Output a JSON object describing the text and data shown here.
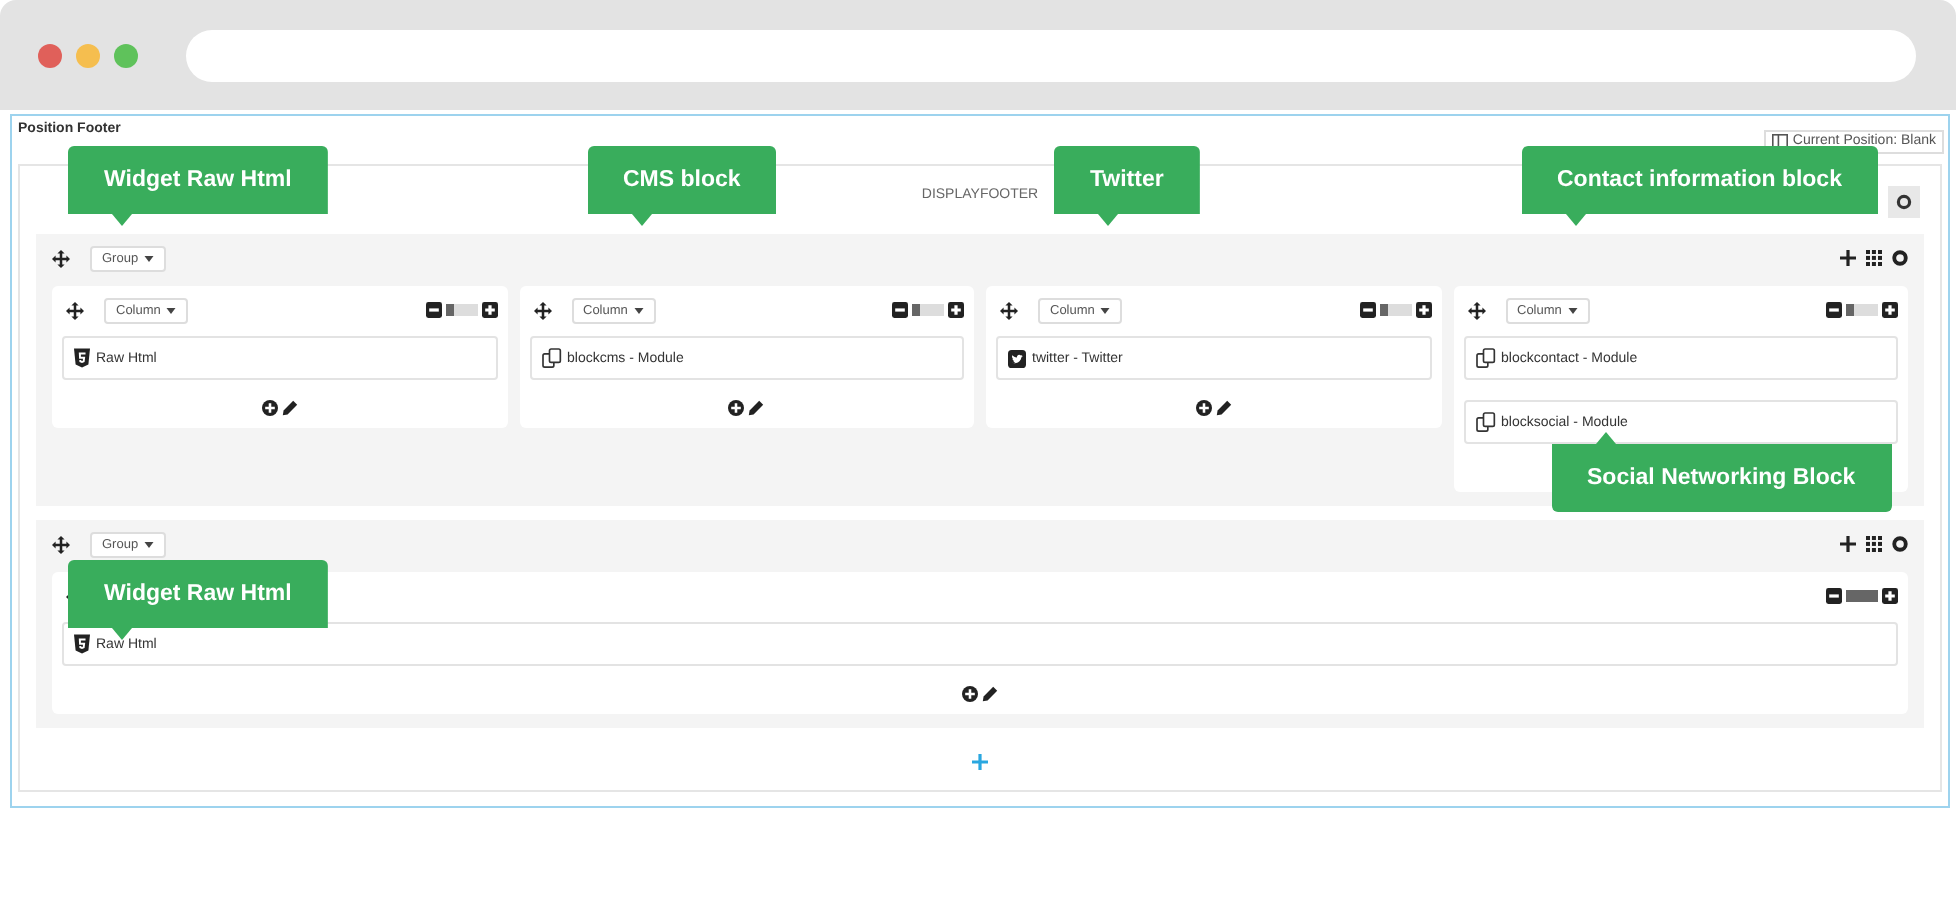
{
  "browser": {
    "dots": [
      {
        "color": "#e0605a"
      },
      {
        "color": "#f5be4f"
      },
      {
        "color": "#5fc25b"
      }
    ]
  },
  "panel": {
    "title": "Position Footer",
    "position_button": "Current Position: Blank",
    "hook": "DISPLAYFOOTER",
    "groups": [
      {
        "label": "Group",
        "columns": [
          {
            "label": "Column",
            "level": 0.25,
            "callout": {
              "text": "Widget Raw Html",
              "kind": "above-start"
            },
            "modules": [
              {
                "kind": "html",
                "text": "Raw Html"
              }
            ]
          },
          {
            "label": "Column",
            "level": 0.25,
            "callout": {
              "text": "CMS block",
              "kind": "above"
            },
            "modules": [
              {
                "kind": "module",
                "text": "blockcms - Module"
              }
            ]
          },
          {
            "label": "Column",
            "level": 0.25,
            "callout": {
              "text": "Twitter",
              "kind": "above"
            },
            "modules": [
              {
                "kind": "twitter",
                "text": "twitter - Twitter"
              }
            ]
          },
          {
            "label": "Column",
            "level": 0.25,
            "callout": {
              "text": "Contact information  block",
              "kind": "above"
            },
            "modules": [
              {
                "kind": "module",
                "text": "blockcontact - Module"
              },
              {
                "kind": "module",
                "text": "blocksocial - Module",
                "callout": {
                  "text": "Social Networking Block",
                  "kind": "below"
                }
              }
            ]
          }
        ]
      },
      {
        "label": "Group",
        "columns": [
          {
            "level": 1,
            "callout": {
              "text": "Widget Raw Html",
              "kind": "over"
            },
            "modules": [
              {
                "kind": "html",
                "text": "Raw Html"
              }
            ]
          }
        ]
      }
    ]
  }
}
